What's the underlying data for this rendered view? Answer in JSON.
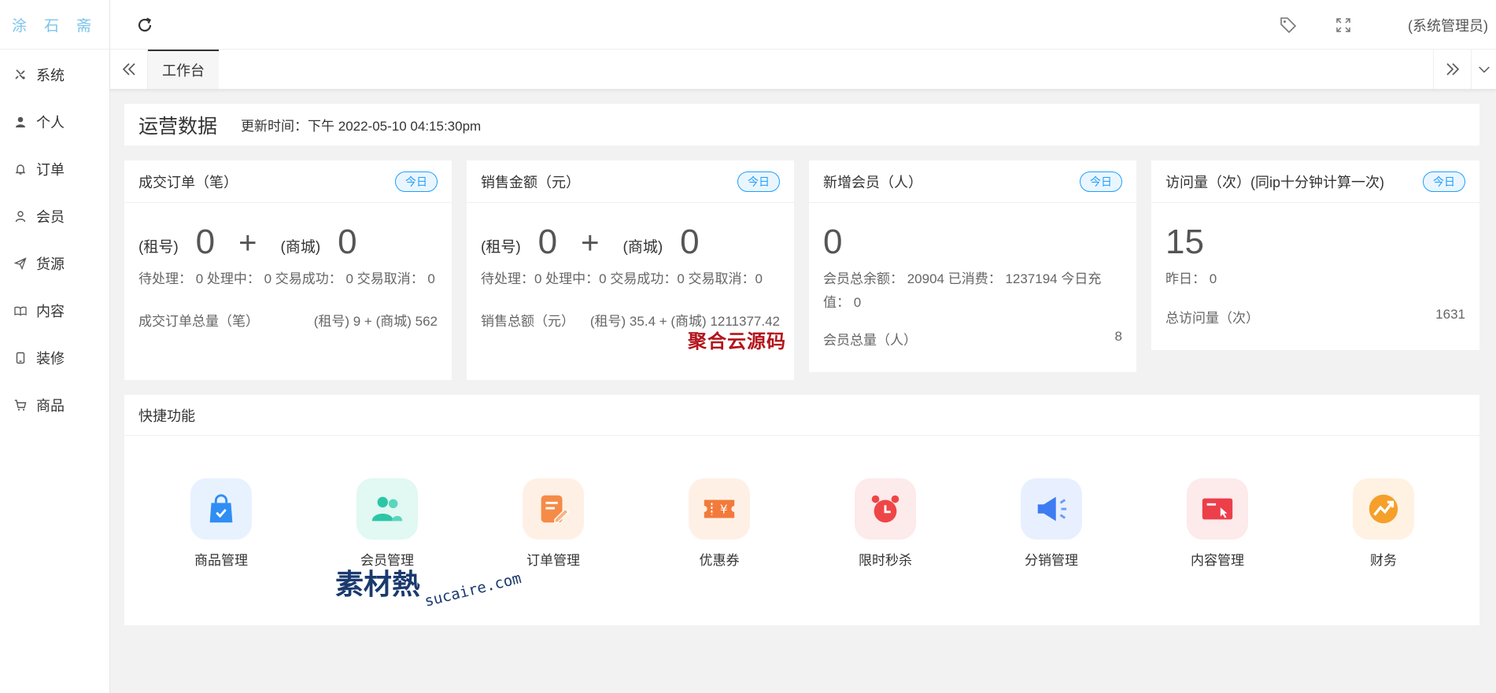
{
  "sidebar": {
    "logo": "涂 石 斋",
    "items": [
      {
        "label": "系统",
        "icon": "tools-icon"
      },
      {
        "label": "个人",
        "icon": "user-filled-icon"
      },
      {
        "label": "订单",
        "icon": "bell-icon"
      },
      {
        "label": "会员",
        "icon": "user-outline-icon"
      },
      {
        "label": "货源",
        "icon": "send-icon"
      },
      {
        "label": "内容",
        "icon": "book-icon"
      },
      {
        "label": "装修",
        "icon": "phone-icon"
      },
      {
        "label": "商品",
        "icon": "cart-icon"
      }
    ]
  },
  "header": {
    "admin_label": "(系统管理员)"
  },
  "tabs": {
    "active": "工作台"
  },
  "ops": {
    "title": "运营数据",
    "update_time": "更新时间：下午 2022-05-10 04:15:30pm"
  },
  "cards": [
    {
      "title": "成交订单（笔）",
      "badge": "今日",
      "left_label": "(租号)",
      "left_value": "0",
      "plus": "+",
      "right_label": "(商城)",
      "right_value": "0",
      "sub": "待处理：  0  处理中：  0  交易成功：  0  交易取消：  0",
      "foot_label": "成交订单总量（笔）",
      "foot_value": "(租号) 9 + (商城) 562"
    },
    {
      "title": "销售金额（元）",
      "badge": "今日",
      "left_label": "(租号)",
      "left_value": "0",
      "plus": "+",
      "right_label": "(商城)",
      "right_value": "0",
      "sub": "待处理：0  处理中：0  交易成功：0  交易取消：0",
      "foot_label": "销售总额（元）",
      "foot_value": "(租号) 35.4 + (商城) 1211377.42"
    },
    {
      "title": "新增会员（人）",
      "badge": "今日",
      "value": "0",
      "sub": "会员总余额：  20904  已消费：  1237194  今日充值：  0",
      "foot_label": "会员总量（人）",
      "foot_value": "8"
    },
    {
      "title": "访问量（次）(同ip十分钟计算一次)",
      "badge": "今日",
      "value": "15",
      "sub": "昨日：  0",
      "foot_label": "总访问量（次）",
      "foot_value": "1631"
    }
  ],
  "quick": {
    "title": "快捷功能",
    "items": [
      {
        "label": "商品管理",
        "icon": "shopping-bag-icon",
        "bg": "#e8f2ff",
        "color": "#2f8ef4"
      },
      {
        "label": "会员管理",
        "icon": "users-icon",
        "bg": "#e1f8f3",
        "color": "#2cc6a6"
      },
      {
        "label": "订单管理",
        "icon": "order-edit-icon",
        "bg": "#fff0e6",
        "color": "#f58b47"
      },
      {
        "label": "优惠券",
        "icon": "coupon-icon",
        "bg": "#fff0e6",
        "color": "#f27a3a"
      },
      {
        "label": "限时秒杀",
        "icon": "alarm-clock-icon",
        "bg": "#fdeaea",
        "color": "#ee4646"
      },
      {
        "label": "分销管理",
        "icon": "megaphone-icon",
        "bg": "#e8f0ff",
        "color": "#3d7cf1"
      },
      {
        "label": "内容管理",
        "icon": "content-card-icon",
        "bg": "#fdeaea",
        "color": "#ec3f4a"
      },
      {
        "label": "财务",
        "icon": "finance-trend-icon",
        "bg": "#fff2e3",
        "color": "#f5a02a"
      }
    ]
  },
  "watermarks": {
    "top": "聚合云源码",
    "bottom_logo": "素材熱",
    "bottom_url": "sucaire.com"
  }
}
